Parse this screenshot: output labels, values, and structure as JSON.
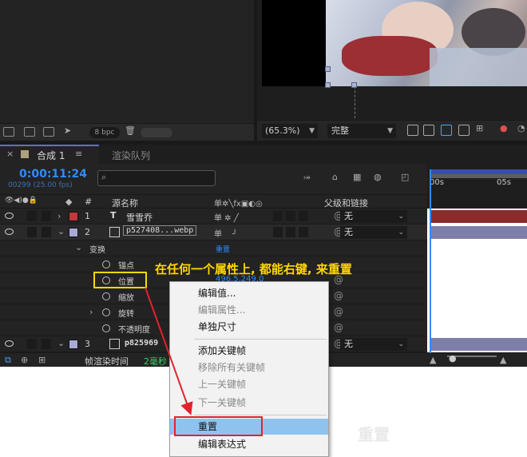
{
  "project": {
    "bpc_label": "8 bpc"
  },
  "viewer": {
    "zoom": "(65.3%)",
    "quality": "完整"
  },
  "tabs": {
    "comp_label": "合成 1",
    "render_queue": "渲染队列"
  },
  "timeline": {
    "timecode": "0:00:11:24",
    "frame_info": "00299 (25.00 fps)",
    "search_placeholder": "",
    "ruler_ticks": [
      "00s",
      "05s"
    ],
    "columns": {
      "hash": "#",
      "source_name": "源名称",
      "parent": "父级和链接"
    },
    "layers": [
      {
        "num": "1",
        "type": "T",
        "name": "雪雪乔",
        "color": "#c0393b",
        "parent": "无"
      },
      {
        "num": "2",
        "name": "p527408...webp",
        "color": "#a9a9d8",
        "parent": "无"
      },
      {
        "num": "3",
        "name": "p825969",
        "color": "#a9a9d8",
        "parent": "无"
      }
    ],
    "transform": {
      "group_label": "变换",
      "reset_link": "重置",
      "properties": [
        "锚点",
        "位置",
        "缩放",
        "旋转",
        "不透明度"
      ],
      "position_value": "496.5,249.0"
    },
    "bottom_label": "帧渲染时间",
    "bottom_value": "2毫秒"
  },
  "annotation": "在任何一个属性上, 都能右键, 来重置",
  "context_menu": {
    "items": [
      {
        "label": "编辑值...",
        "disabled": false
      },
      {
        "label": "编辑属性...",
        "disabled": true
      },
      {
        "label": "单独尺寸",
        "disabled": false
      },
      {
        "label": "添加关键帧",
        "disabled": false
      },
      {
        "label": "移除所有关键帧",
        "disabled": true
      },
      {
        "label": "上一关键帧",
        "disabled": true
      },
      {
        "label": "下一关键帧",
        "disabled": true
      },
      {
        "label": "重置",
        "disabled": false,
        "highlighted": true
      },
      {
        "label": "编辑表达式",
        "disabled": false
      }
    ]
  },
  "background": {
    "ghost_text": "重置"
  },
  "colors": {
    "accent_blue": "#2f8bff",
    "annotation_yellow": "#ffd800",
    "highlight_red": "#e0242a",
    "menu_highlight": "#8fc3ee"
  }
}
